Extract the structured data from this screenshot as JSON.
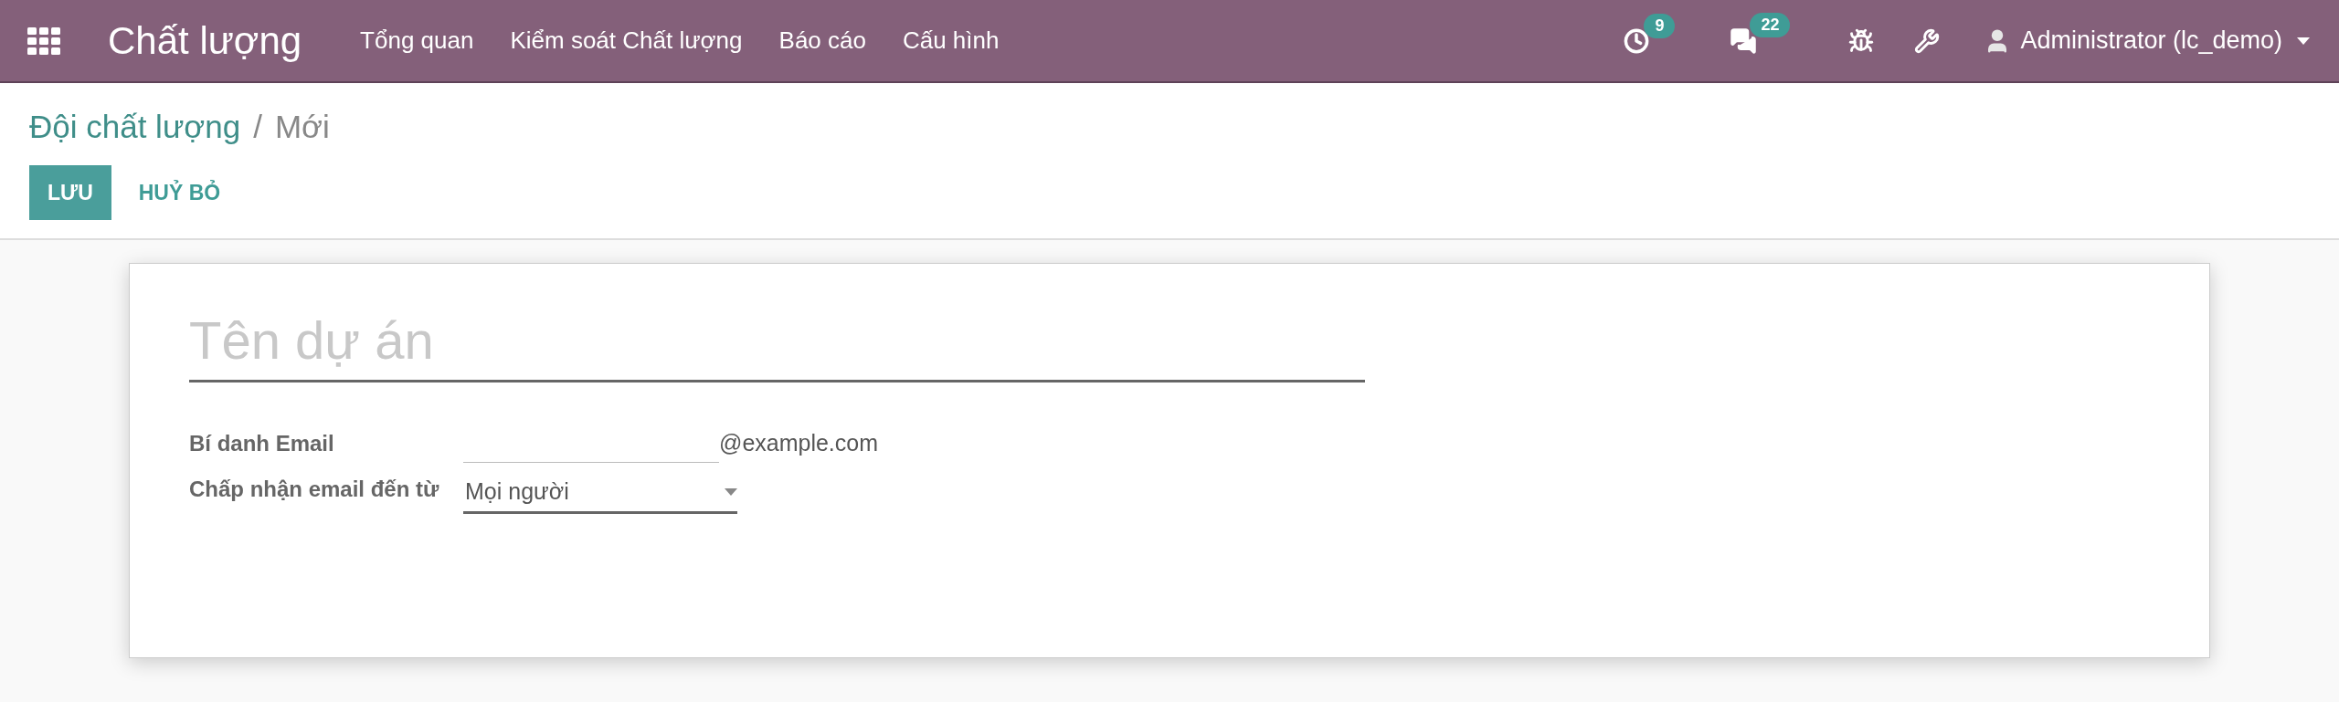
{
  "navbar": {
    "brand": "Chất lượng",
    "menu": [
      "Tổng quan",
      "Kiểm soát Chất lượng",
      "Báo cáo",
      "Cấu hình"
    ],
    "activity_count": "9",
    "message_count": "22",
    "user": "Administrator (lc_demo)"
  },
  "breadcrumb": {
    "parent": "Đội chất lượng",
    "separator": "/",
    "current": "Mới"
  },
  "buttons": [
    {
      "label": "LƯU",
      "kind": "primary"
    },
    {
      "label": "HUỶ BỎ",
      "kind": "secondary"
    }
  ],
  "form": {
    "title": {
      "placeholder": "Tên dự án"
    },
    "fields": [
      {
        "label": "Bí danh Email",
        "kind": "alias",
        "suffix": "@example.com"
      },
      {
        "label": "Chấp nhận email đến từ",
        "kind": "select",
        "value": "Mọi người"
      }
    ]
  }
}
